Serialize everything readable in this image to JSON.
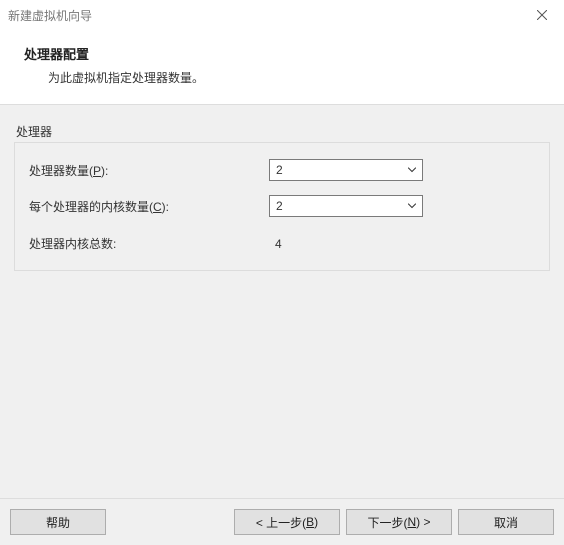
{
  "window": {
    "title": "新建虚拟机向导"
  },
  "header": {
    "heading": "处理器配置",
    "subheading": "为此虚拟机指定处理器数量。"
  },
  "group": {
    "title": "处理器",
    "rows": {
      "num_processors": {
        "label_prefix": "处理器数量(",
        "hotkey": "P",
        "label_suffix": "):",
        "value": "2"
      },
      "cores_per_processor": {
        "label_prefix": "每个处理器的内核数量(",
        "hotkey": "C",
        "label_suffix": "):",
        "value": "2"
      },
      "total_cores": {
        "label": "处理器内核总数:",
        "value": "4"
      }
    }
  },
  "footer": {
    "help": "帮助",
    "back_prefix": "< 上一步(",
    "back_hotkey": "B",
    "back_suffix": ")",
    "next_prefix": "下一步(",
    "next_hotkey": "N",
    "next_suffix": ") >",
    "cancel": "取消"
  }
}
